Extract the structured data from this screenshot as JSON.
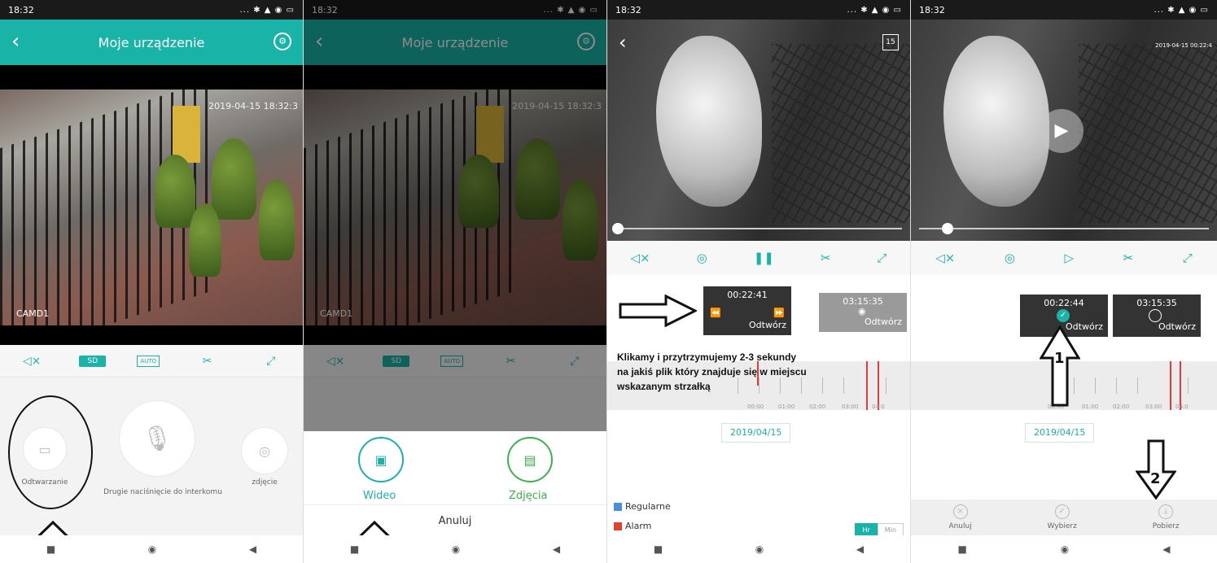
{
  "status_time": "18:32",
  "phone1": {
    "title": "Moje urządzenie",
    "osd_time": "2019-04-15 18:32:3",
    "osd_cam": "CAMD1",
    "sd_label": "SD",
    "auto_label": "AUTO",
    "playback_label": "Odtwarzanie",
    "intercom_label": "Drugie naciśnięcie do interkomu",
    "photo_label": "zdjęcie"
  },
  "phone2": {
    "title": "Moje urządzenie",
    "video_label": "Wideo",
    "photos_label": "Zdjęcia",
    "cancel_label": "Anuluj"
  },
  "phone3": {
    "calendar_day": "15",
    "clip1_time": "00:22:41",
    "clip1_play": "Odtwórz",
    "clip2_time": "03:15:35",
    "clip2_play": "Odtwórz",
    "note_line1": "Klikamy i przytrzymujemy 2-3 sekundy",
    "note_line2": "na jakiś plik który znajduje się w miejscu",
    "note_line3": "wskazanym strzałką",
    "date": "2019/04/15",
    "legend_regular": "Regularne",
    "legend_alarm": "Alarm",
    "tab_hr": "Hr",
    "tab_min": "Min",
    "tl_labels": [
      "00:00",
      "01:00",
      "02:00",
      "03:00",
      "04:0"
    ],
    "colors": {
      "regular": "#4a90d9",
      "alarm": "#e0432b",
      "accent": "#19b3a8"
    }
  },
  "phone4": {
    "osd_time": "2019-04-15 00:22:4",
    "clip1_time": "00:22:44",
    "clip1_play": "Odtwórz",
    "clip2_time": "03:15:35",
    "clip2_play": "Odtwórz",
    "date": "2019/04/15",
    "marker1": "1",
    "marker2": "2",
    "act_cancel": "Anuluj",
    "act_select": "Wybierz",
    "act_download": "Pobierz",
    "tl_labels": [
      "00:00",
      "01:00",
      "02:00",
      "03:00",
      "04:0"
    ]
  }
}
